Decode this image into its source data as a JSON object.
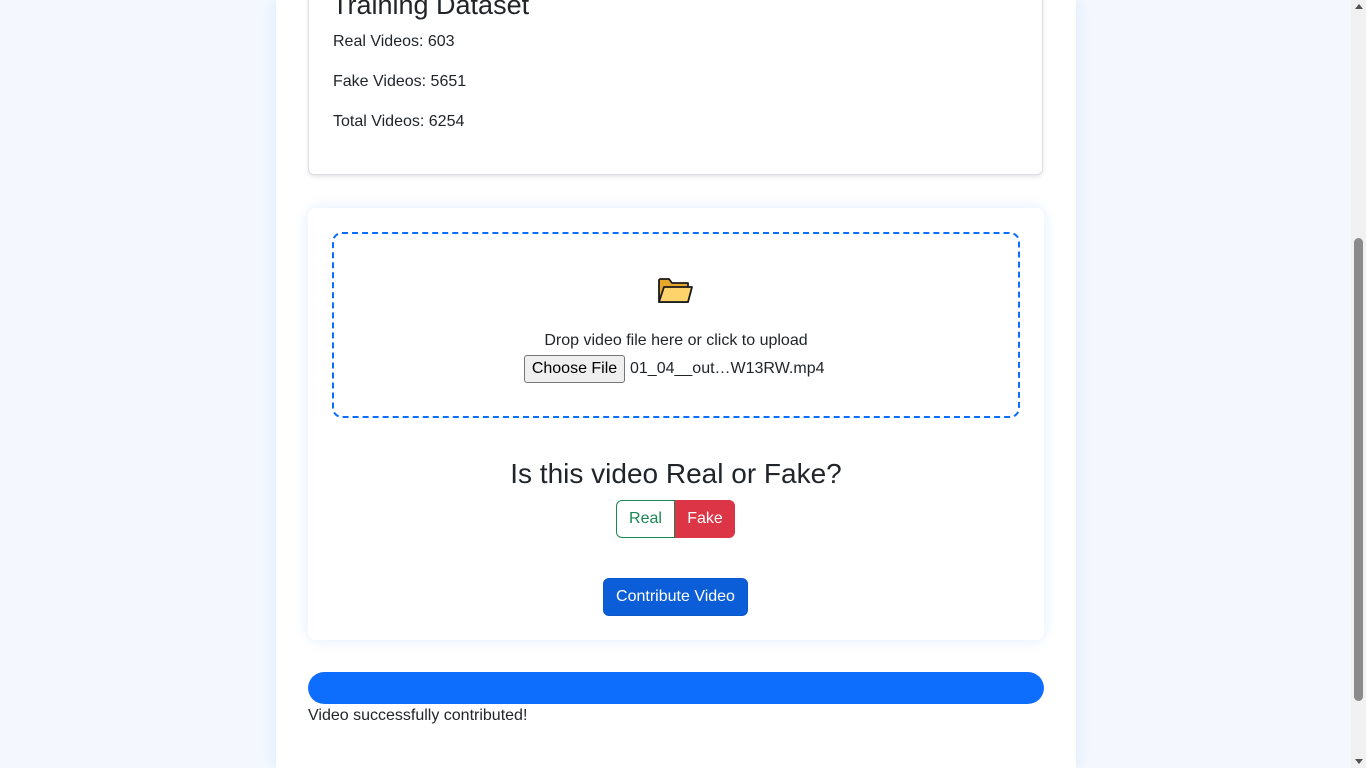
{
  "dataset": {
    "title": "Training Dataset",
    "real_videos": "Real Videos: 603",
    "fake_videos": "Fake Videos: 5651",
    "total_videos": "Total Videos: 6254"
  },
  "upload": {
    "icon": "folder-icon",
    "drop_text": "Drop video file here or click to upload",
    "choose_file_label": "Choose File",
    "file_name": "01_04__out…W13RW.mp4"
  },
  "label_question": {
    "question": "Is this video Real or Fake?",
    "real_label": "Real",
    "fake_label": "Fake",
    "selected": "Fake"
  },
  "contribute": {
    "button_label": "Contribute Video"
  },
  "progress": {
    "percent": 100,
    "status": "Video successfully contributed!"
  },
  "colors": {
    "primary": "#0d6efd",
    "success": "#198754",
    "danger": "#dc3545"
  }
}
